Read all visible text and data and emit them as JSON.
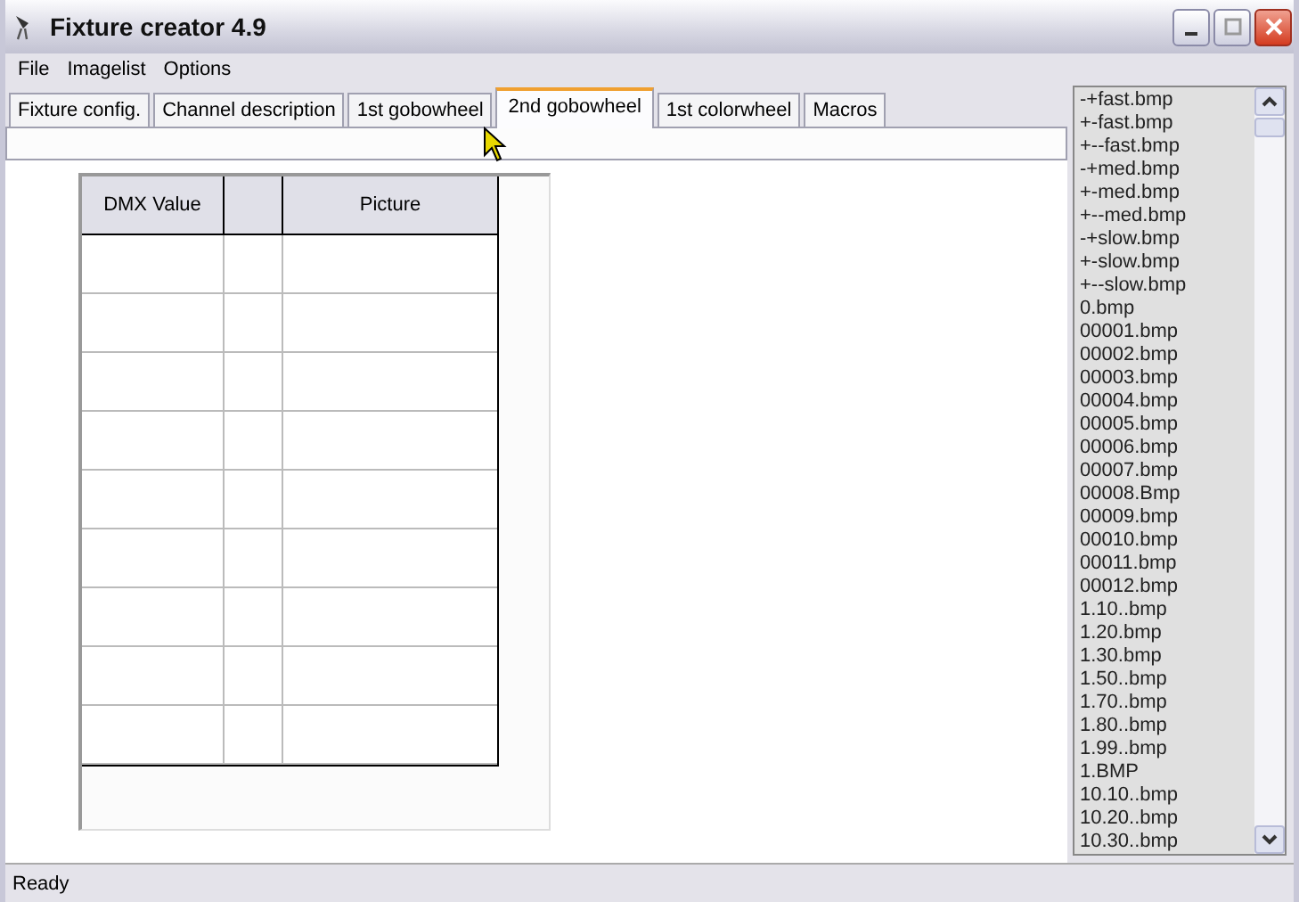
{
  "window": {
    "title": "Fixture creator 4.9"
  },
  "menu": [
    "File",
    "Imagelist",
    "Options"
  ],
  "tabs": [
    {
      "label": "Fixture config.",
      "selected": false
    },
    {
      "label": "Channel description",
      "selected": false
    },
    {
      "label": "1st gobowheel",
      "selected": false
    },
    {
      "label": "2nd gobowheel",
      "selected": true
    },
    {
      "label": "1st colorwheel",
      "selected": false
    },
    {
      "label": "Macros",
      "selected": false
    }
  ],
  "table": {
    "columns": [
      {
        "kind": "text",
        "label": "DMX Value"
      },
      {
        "kind": "blank"
      },
      {
        "kind": "text",
        "label": "Picture"
      }
    ],
    "rows": [
      {
        "selected": false
      },
      {
        "selected": false
      },
      {
        "selected": false
      },
      {
        "selected": false
      },
      {
        "selected": false
      },
      {
        "selected": false
      },
      {
        "selected": false
      },
      {
        "selected": false
      },
      {
        "selected": false
      }
    ]
  },
  "image_list": [
    "-+fast.bmp",
    "+-fast.bmp",
    "+--fast.bmp",
    "-+med.bmp",
    "+-med.bmp",
    "+--med.bmp",
    "-+slow.bmp",
    "+-slow.bmp",
    "+--slow.bmp",
    "0.bmp",
    "00001.bmp",
    "00002.bmp",
    "00003.bmp",
    "00004.bmp",
    "00005.bmp",
    "00006.bmp",
    "00007.bmp",
    "00008.Bmp",
    "00009.bmp",
    "00010.bmp",
    "00011.bmp",
    "00012.bmp",
    "1.10..bmp",
    "1.20.bmp",
    "1.30.bmp",
    "1.50..bmp",
    "1.70..bmp",
    "1.80..bmp",
    "1.99..bmp",
    "1.BMP",
    "10.10..bmp",
    "10.20..bmp",
    "10.30..bmp"
  ],
  "status_bar": "Ready"
}
